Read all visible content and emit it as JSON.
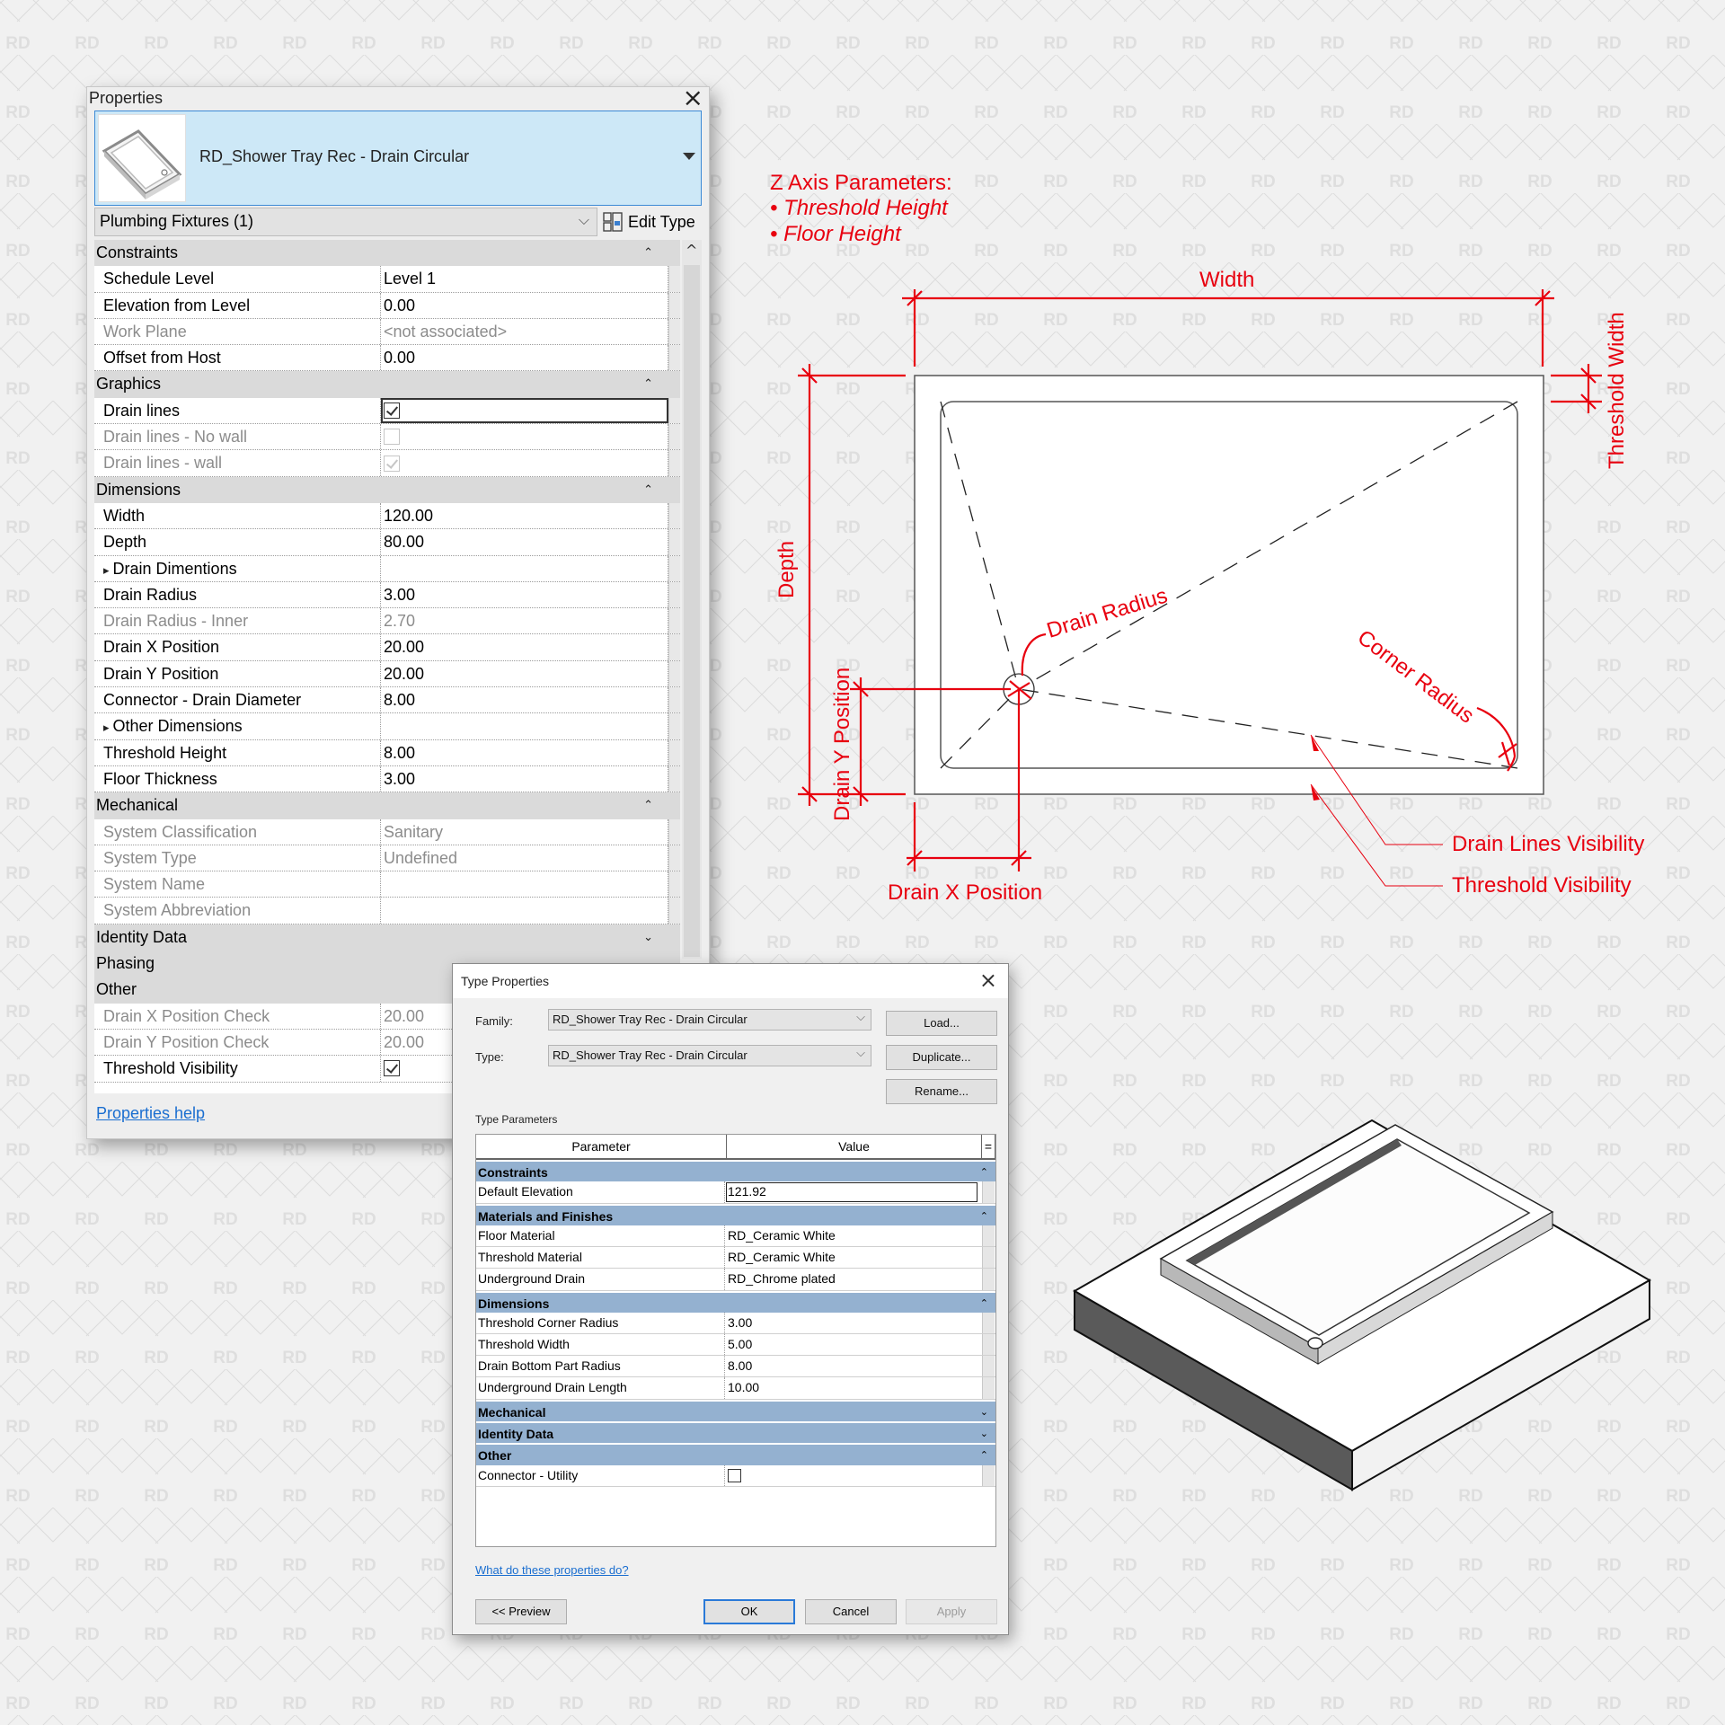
{
  "properties_palette": {
    "title": "Properties",
    "type_name": "RD_Shower Tray Rec - Drain Circular",
    "thumbnail_icon": "shower-tray-thumbnail",
    "filter": "Plumbing Fixtures (1)",
    "edit_type_label": "Edit Type",
    "groups": [
      {
        "name": "Constraints",
        "collapsed": false,
        "rows": [
          {
            "key": "Schedule Level",
            "value": "Level 1",
            "enabled": true
          },
          {
            "key": "Elevation from Level",
            "value": "0.00",
            "enabled": true
          },
          {
            "key": "Work Plane",
            "value": "<not associated>",
            "enabled": false
          },
          {
            "key": "Offset from Host",
            "value": "0.00",
            "enabled": true
          }
        ]
      },
      {
        "name": "Graphics",
        "collapsed": false,
        "rows": [
          {
            "key": "Drain lines",
            "checkbox": true,
            "checked": true,
            "enabled": true,
            "focused": true
          },
          {
            "key": "Drain lines - No wall",
            "checkbox": true,
            "checked": false,
            "enabled": false
          },
          {
            "key": "Drain lines - wall",
            "checkbox": true,
            "checked": true,
            "enabled": false
          }
        ]
      },
      {
        "name": "Dimensions",
        "collapsed": false,
        "rows": [
          {
            "key": "Width",
            "value": "120.00",
            "enabled": true
          },
          {
            "key": "Depth",
            "value": "80.00",
            "enabled": true
          },
          {
            "key": "Drain Dimentions",
            "value": "",
            "enabled": true,
            "subheader": true
          },
          {
            "key": "Drain Radius",
            "value": "3.00",
            "enabled": true
          },
          {
            "key": "Drain Radius - Inner",
            "value": "2.70",
            "enabled": false
          },
          {
            "key": "Drain X Position",
            "value": "20.00",
            "enabled": true
          },
          {
            "key": "Drain Y Position",
            "value": "20.00",
            "enabled": true
          },
          {
            "key": "Connector - Drain Diameter",
            "value": "8.00",
            "enabled": true
          },
          {
            "key": "Other Dimensions",
            "value": "",
            "enabled": true,
            "subheader": true
          },
          {
            "key": "Threshold Height",
            "value": "8.00",
            "enabled": true
          },
          {
            "key": "Floor Thickness",
            "value": "3.00",
            "enabled": true
          }
        ]
      },
      {
        "name": "Mechanical",
        "collapsed": false,
        "rows": [
          {
            "key": "System Classification",
            "value": "Sanitary",
            "enabled": false
          },
          {
            "key": "System Type",
            "value": "Undefined",
            "enabled": false
          },
          {
            "key": "System Name",
            "value": "",
            "enabled": false
          },
          {
            "key": "System Abbreviation",
            "value": "",
            "enabled": false
          }
        ]
      },
      {
        "name": "Identity Data",
        "collapsed": true,
        "rows": []
      },
      {
        "name": "Phasing",
        "collapsed": true,
        "rows": []
      },
      {
        "name": "Other",
        "collapsed": false,
        "rows": [
          {
            "key": "Drain X Position Check",
            "value": "20.00",
            "enabled": false
          },
          {
            "key": "Drain Y Position Check",
            "value": "20.00",
            "enabled": false
          },
          {
            "key": "Threshold Visibility",
            "checkbox": true,
            "checked": true,
            "enabled": true
          }
        ]
      }
    ],
    "help_link": "Properties help"
  },
  "type_properties": {
    "title": "Type Properties",
    "family_label": "Family:",
    "family_value": "RD_Shower Tray Rec - Drain Circular",
    "type_label": "Type:",
    "type_value": "RD_Shower Tray Rec - Drain Circular",
    "load_button": "Load...",
    "duplicate_button": "Duplicate...",
    "rename_button": "Rename...",
    "section_label": "Type Parameters",
    "col_parameter": "Parameter",
    "col_value": "Value",
    "col_eq": "=",
    "groups": [
      {
        "name": "Constraints",
        "collapsed": false,
        "rows": [
          {
            "key": "Default Elevation",
            "value": "121.92",
            "editing": true
          }
        ]
      },
      {
        "name": "Materials and Finishes",
        "collapsed": false,
        "rows": [
          {
            "key": "Floor Material",
            "value": "RD_Ceramic White"
          },
          {
            "key": "Threshold Material",
            "value": "RD_Ceramic White"
          },
          {
            "key": "Underground Drain",
            "value": "RD_Chrome plated"
          }
        ]
      },
      {
        "name": "Dimensions",
        "collapsed": false,
        "rows": [
          {
            "key": "Threshold Corner Radius",
            "value": "3.00"
          },
          {
            "key": "Threshold Width",
            "value": "5.00"
          },
          {
            "key": "Drain Bottom Part Radius",
            "value": "8.00"
          },
          {
            "key": "Underground Drain Length",
            "value": "10.00"
          }
        ]
      },
      {
        "name": "Mechanical",
        "collapsed": true,
        "rows": []
      },
      {
        "name": "Identity Data",
        "collapsed": true,
        "rows": []
      },
      {
        "name": "Other",
        "collapsed": false,
        "rows": [
          {
            "key": "Connector - Utility",
            "checkbox": true,
            "checked": false
          }
        ]
      }
    ],
    "help_link": "What do these properties do?",
    "preview_button": "<< Preview",
    "ok_button": "OK",
    "cancel_button": "Cancel",
    "apply_button": "Apply",
    "apply_enabled": false
  },
  "diagram": {
    "annotation_color": "#e8000f",
    "z_axis_title": "Z Axis Parameters:",
    "z_axis_items": [
      "• Threshold Height",
      "• Floor Height"
    ],
    "labels": {
      "width": "Width",
      "depth": "Depth",
      "threshold_width": "Threshold Width",
      "drain_radius": "Drain Radius",
      "corner_radius": "Corner Radius",
      "drain_y_position": "Drain Y Position",
      "drain_x_position": "Drain X Position",
      "drain_lines_visibility": "Drain Lines Visibility",
      "threshold_visibility": "Threshold Visibility"
    }
  },
  "render_3d": {
    "subject": "shower-tray-isometric-render"
  }
}
